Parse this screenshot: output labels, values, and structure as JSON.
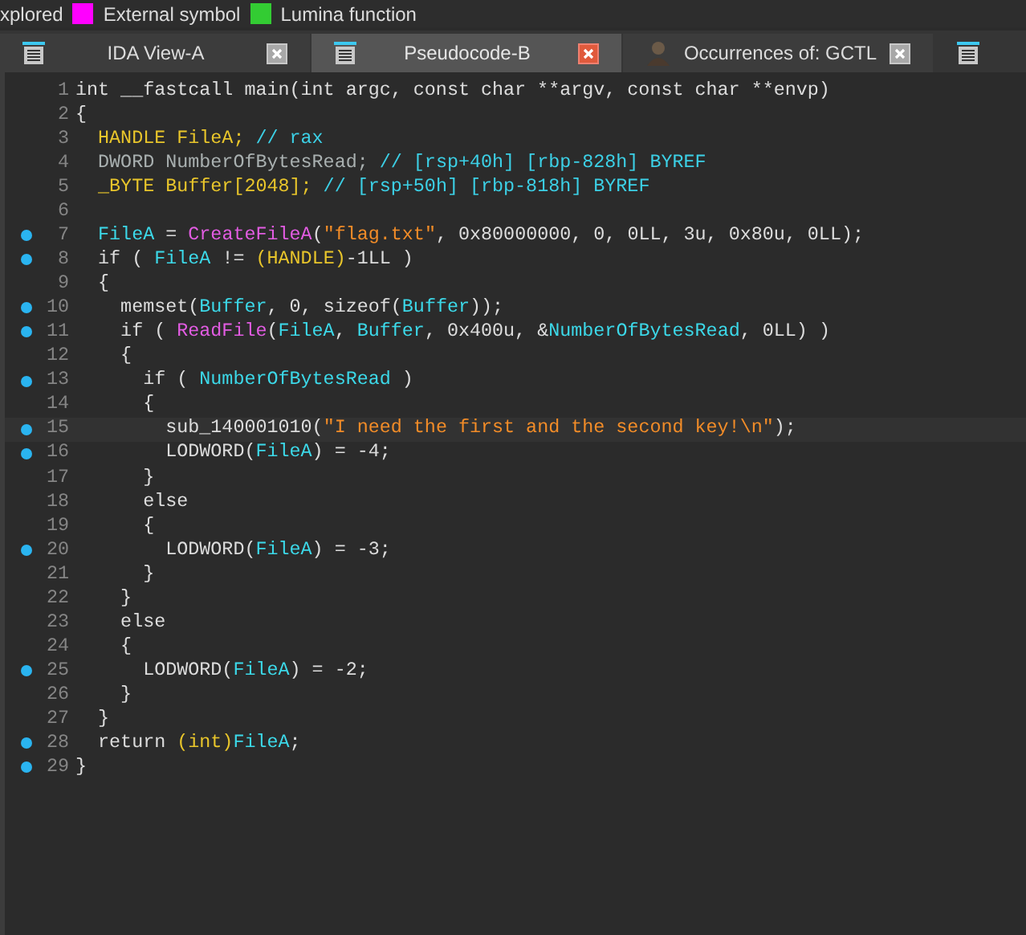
{
  "legend": [
    {
      "label": "xplored"
    },
    {
      "label": "External symbol",
      "color": "#ff00ff"
    },
    {
      "label": "Lumina function",
      "color": "#33cc33"
    }
  ],
  "tabs": [
    {
      "label": "IDA View-A",
      "selected": false
    },
    {
      "label": "Pseudocode-B",
      "selected": true
    },
    {
      "label": "Occurrences of: GCTL",
      "selected": false
    },
    {
      "selected": false
    }
  ],
  "lines": [
    {
      "number": "1",
      "breakpoint": false,
      "highlighted": false,
      "tokens": [
        {
          "kind": "plain",
          "text": "int __fastcall main(int argc, const char **argv, const char **envp)"
        }
      ]
    },
    {
      "number": "2",
      "breakpoint": false,
      "highlighted": false,
      "tokens": [
        {
          "kind": "plain",
          "text": "{"
        }
      ]
    },
    {
      "number": "3",
      "breakpoint": false,
      "highlighted": false,
      "tokens": [
        {
          "kind": "type",
          "text": "  HANDLE FileA;"
        },
        {
          "kind": "comment",
          "text": " // rax"
        }
      ]
    },
    {
      "number": "4",
      "breakpoint": false,
      "highlighted": false,
      "tokens": [
        {
          "kind": "dim",
          "text": "  DWORD NumberOfBytesRead;"
        },
        {
          "kind": "comment",
          "text": " // [rsp+40h] [rbp-828h] BYREF"
        }
      ]
    },
    {
      "number": "5",
      "breakpoint": false,
      "highlighted": false,
      "tokens": [
        {
          "kind": "type",
          "text": "  _BYTE Buffer[2048];"
        },
        {
          "kind": "comment",
          "text": " // [rsp+50h] [rbp-818h] BYREF"
        }
      ]
    },
    {
      "number": "6",
      "breakpoint": false,
      "highlighted": false
    },
    {
      "number": "7",
      "breakpoint": true,
      "highlighted": false,
      "tokens": [
        {
          "kind": "var",
          "text": "  FileA"
        },
        {
          "kind": "plain",
          "text": " = "
        },
        {
          "kind": "func",
          "text": "CreateFileA"
        },
        {
          "kind": "plain",
          "text": "("
        },
        {
          "kind": "string",
          "text": "\"flag.txt\""
        },
        {
          "kind": "plain",
          "text": ", 0x80000000, 0, 0LL, 3u, 0x80u, 0LL);"
        }
      ]
    },
    {
      "number": "8",
      "breakpoint": true,
      "highlighted": false,
      "tokens": [
        {
          "kind": "plain",
          "text": "  if ( "
        },
        {
          "kind": "var",
          "text": "FileA"
        },
        {
          "kind": "plain",
          "text": " != "
        },
        {
          "kind": "type",
          "text": "(HANDLE)"
        },
        {
          "kind": "plain",
          "text": "-1LL )"
        }
      ]
    },
    {
      "number": "9",
      "breakpoint": false,
      "highlighted": false,
      "tokens": [
        {
          "kind": "plain",
          "text": "  {"
        }
      ]
    },
    {
      "number": "10",
      "breakpoint": true,
      "highlighted": false,
      "tokens": [
        {
          "kind": "plain",
          "text": "    memset("
        },
        {
          "kind": "var",
          "text": "Buffer"
        },
        {
          "kind": "plain",
          "text": ", 0, sizeof("
        },
        {
          "kind": "var",
          "text": "Buffer"
        },
        {
          "kind": "plain",
          "text": "));"
        }
      ]
    },
    {
      "number": "11",
      "breakpoint": true,
      "highlighted": false,
      "tokens": [
        {
          "kind": "plain",
          "text": "    if ( "
        },
        {
          "kind": "func",
          "text": "ReadFile"
        },
        {
          "kind": "plain",
          "text": "("
        },
        {
          "kind": "var",
          "text": "FileA"
        },
        {
          "kind": "plain",
          "text": ", "
        },
        {
          "kind": "var",
          "text": "Buffer"
        },
        {
          "kind": "plain",
          "text": ", 0x400u, &"
        },
        {
          "kind": "var",
          "text": "NumberOfBytesRead"
        },
        {
          "kind": "plain",
          "text": ", 0LL) )"
        }
      ]
    },
    {
      "number": "12",
      "breakpoint": false,
      "highlighted": false,
      "tokens": [
        {
          "kind": "plain",
          "text": "    {"
        }
      ]
    },
    {
      "number": "13",
      "breakpoint": true,
      "highlighted": false,
      "tokens": [
        {
          "kind": "plain",
          "text": "      if ( "
        },
        {
          "kind": "var",
          "text": "NumberOfBytesRead"
        },
        {
          "kind": "plain",
          "text": " )"
        }
      ]
    },
    {
      "number": "14",
      "breakpoint": false,
      "highlighted": false,
      "tokens": [
        {
          "kind": "plain",
          "text": "      {"
        }
      ]
    },
    {
      "number": "15",
      "breakpoint": true,
      "highlighted": true,
      "tokens": [
        {
          "kind": "plain",
          "text": "        sub_140001010("
        },
        {
          "kind": "string",
          "text": "\"I need the first and the second key!\\n\""
        },
        {
          "kind": "plain",
          "text": ");"
        }
      ]
    },
    {
      "number": "16",
      "breakpoint": true,
      "highlighted": false,
      "tokens": [
        {
          "kind": "plain",
          "text": "        LODWORD("
        },
        {
          "kind": "var",
          "text": "FileA"
        },
        {
          "kind": "plain",
          "text": ") = -4;"
        }
      ]
    },
    {
      "number": "17",
      "breakpoint": false,
      "highlighted": false,
      "tokens": [
        {
          "kind": "plain",
          "text": "      }"
        }
      ]
    },
    {
      "number": "18",
      "breakpoint": false,
      "highlighted": false,
      "tokens": [
        {
          "kind": "plain",
          "text": "      else"
        }
      ]
    },
    {
      "number": "19",
      "breakpoint": false,
      "highlighted": false,
      "tokens": [
        {
          "kind": "plain",
          "text": "      {"
        }
      ]
    },
    {
      "number": "20",
      "breakpoint": true,
      "highlighted": false,
      "tokens": [
        {
          "kind": "plain",
          "text": "        LODWORD("
        },
        {
          "kind": "var",
          "text": "FileA"
        },
        {
          "kind": "plain",
          "text": ") = -3;"
        }
      ]
    },
    {
      "number": "21",
      "breakpoint": false,
      "highlighted": false,
      "tokens": [
        {
          "kind": "plain",
          "text": "      }"
        }
      ]
    },
    {
      "number": "22",
      "breakpoint": false,
      "highlighted": false,
      "tokens": [
        {
          "kind": "plain",
          "text": "    }"
        }
      ]
    },
    {
      "number": "23",
      "breakpoint": false,
      "highlighted": false,
      "tokens": [
        {
          "kind": "plain",
          "text": "    else"
        }
      ]
    },
    {
      "number": "24",
      "breakpoint": false,
      "highlighted": false,
      "tokens": [
        {
          "kind": "plain",
          "text": "    {"
        }
      ]
    },
    {
      "number": "25",
      "breakpoint": true,
      "highlighted": false,
      "tokens": [
        {
          "kind": "plain",
          "text": "      LODWORD("
        },
        {
          "kind": "var",
          "text": "FileA"
        },
        {
          "kind": "plain",
          "text": ") = -2;"
        }
      ]
    },
    {
      "number": "26",
      "breakpoint": false,
      "highlighted": false,
      "tokens": [
        {
          "kind": "plain",
          "text": "    }"
        }
      ]
    },
    {
      "number": "27",
      "breakpoint": false,
      "highlighted": false,
      "tokens": [
        {
          "kind": "plain",
          "text": "  }"
        }
      ]
    },
    {
      "number": "28",
      "breakpoint": true,
      "highlighted": false,
      "tokens": [
        {
          "kind": "plain",
          "text": "  return "
        },
        {
          "kind": "type",
          "text": "(int)"
        },
        {
          "kind": "var",
          "text": "FileA"
        },
        {
          "kind": "plain",
          "text": ";"
        }
      ]
    },
    {
      "number": "29",
      "breakpoint": true,
      "highlighted": false,
      "tokens": [
        {
          "kind": "plain",
          "text": "}"
        }
      ]
    }
  ]
}
